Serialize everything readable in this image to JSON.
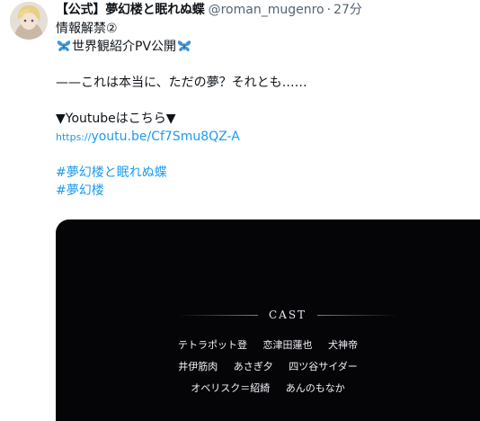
{
  "tweet": {
    "display_name": "【公式】夢幻楼と眠れぬ蝶",
    "handle": "@roman_mugenro",
    "separator": "·",
    "time": "27分",
    "line1": "情報解禁②",
    "line2_text": "世界観紹介PV公開",
    "line3": "——これは本当に、ただの夢？それとも……",
    "line4": "▼Youtubeはこちら▼",
    "link_scheme": "https://",
    "link_rest": "youtu.be/Cf7Smu8QZ-A",
    "hashtag1": "#夢幻楼と眠れぬ蝶",
    "hashtag2": "#夢幻楼"
  },
  "media": {
    "heading": "CAST",
    "cast_rows": [
      [
        "テトラポット登",
        "恋津田蓮也",
        "犬神帝"
      ],
      [
        "井伊筋肉",
        "あさぎ夕",
        "四ツ谷サイダー"
      ],
      [
        "オベリスク＝紹綺",
        "あんのもなか"
      ]
    ]
  },
  "icons": {
    "butterfly": "butterfly-icon",
    "avatar": "avatar"
  },
  "colors": {
    "link": "#1d9bf0",
    "secondary_text": "#536471",
    "media_background": "#050507"
  }
}
